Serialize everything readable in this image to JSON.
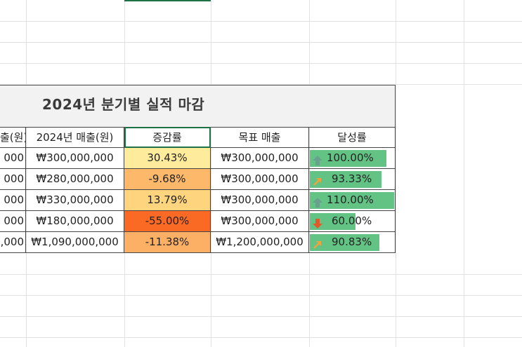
{
  "title": "2024년 분기별 실적 마감",
  "headers": [
    "출(원)",
    "2024년 매출(원)",
    "증감률",
    "목표 매출",
    "달성률"
  ],
  "rows": [
    {
      "prev": "000",
      "sales": "₩300,000,000",
      "change": "30.43%",
      "change_color": "#ffeb9c",
      "target": "₩300,000,000",
      "achieve": "100.00%",
      "achieve_value": 1.0,
      "icon": "up-arrow-icon"
    },
    {
      "prev": "000",
      "sales": "₩280,000,000",
      "change": "-9.68%",
      "change_color": "#fdb86a",
      "target": "₩300,000,000",
      "achieve": "93.33%",
      "achieve_value": 0.9333,
      "icon": "up-right-arrow-icon"
    },
    {
      "prev": "000",
      "sales": "₩330,000,000",
      "change": "13.79%",
      "change_color": "#fed57e",
      "target": "₩300,000,000",
      "achieve": "110.00%",
      "achieve_value": 1.1,
      "icon": "up-arrow-icon"
    },
    {
      "prev": "000",
      "sales": "₩180,000,000",
      "change": "-55.00%",
      "change_color": "#fa6a24",
      "target": "₩300,000,000",
      "achieve": "60.00%",
      "achieve_value": 0.6,
      "icon": "down-arrow-icon"
    },
    {
      "prev": ",000",
      "sales": "₩1,090,000,000",
      "change": "-11.38%",
      "change_color": "#fcb066",
      "target": "₩1,200,000,000",
      "achieve": "90.83%",
      "achieve_value": 0.9083,
      "icon": "up-right-arrow-icon"
    }
  ],
  "colors": {
    "databar": "#63c384",
    "selection": "#1e7145",
    "up_icon": "#6aa08e",
    "up_right_icon": "#f0a33d",
    "down_icon": "#e2592c"
  }
}
